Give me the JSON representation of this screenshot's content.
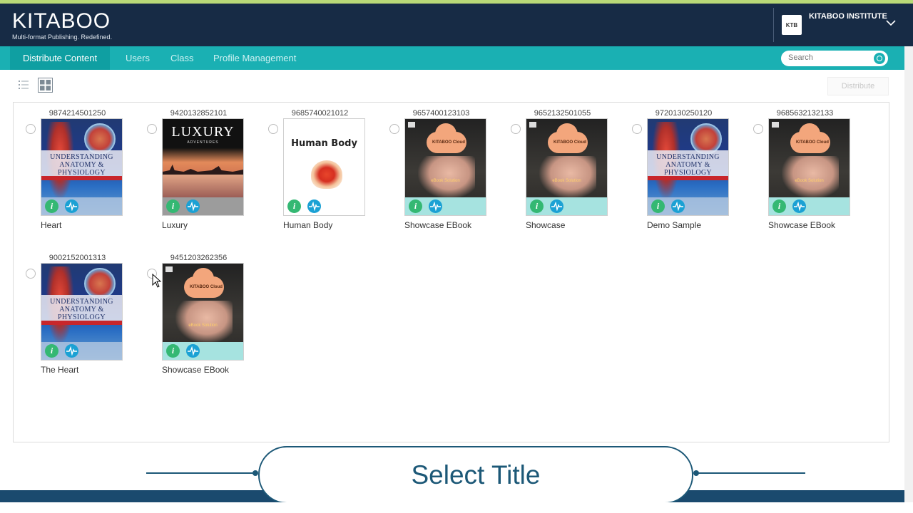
{
  "header": {
    "logo": "KITABOO",
    "tagline": "Multi-format Publishing. Redefined.",
    "institute_name": "KITABOO INSTITUTE",
    "avatar_text": "KTB"
  },
  "nav": {
    "items": [
      {
        "label": "Distribute Content",
        "active": true
      },
      {
        "label": "Users",
        "active": false
      },
      {
        "label": "Class",
        "active": false
      },
      {
        "label": "Profile Management",
        "active": false
      }
    ],
    "search_placeholder": "Search"
  },
  "toolbar": {
    "distribute_label": "Distribute"
  },
  "books": [
    {
      "isbn": "9874214501250",
      "title": "Heart",
      "cover": "anatomy"
    },
    {
      "isbn": "9420132852101",
      "title": "Luxury",
      "cover": "luxury"
    },
    {
      "isbn": "9685740021012",
      "title": "Human Body",
      "cover": "human"
    },
    {
      "isbn": "9657400123103",
      "title": "Showcase EBook",
      "cover": "showcase"
    },
    {
      "isbn": "9652132501055",
      "title": "Showcase",
      "cover": "showcase"
    },
    {
      "isbn": "9720130250120",
      "title": "Demo Sample",
      "cover": "anatomy"
    },
    {
      "isbn": "9685632132133",
      "title": "Showcase EBook",
      "cover": "showcase"
    },
    {
      "isbn": "9002152001313",
      "title": "The Heart",
      "cover": "anatomy"
    },
    {
      "isbn": "9451203262356",
      "title": "Showcase EBook",
      "cover": "showcase"
    }
  ],
  "covers": {
    "anatomy_text": "UNDERSTANDING ANATOMY & PHYSIOLOGY",
    "luxury_title": "LUXURY",
    "luxury_sub": "ADVENTURES",
    "human_title": "Human Body",
    "showcase_cloud": "KITABOO Cloud",
    "showcase_label": "eBook Solution"
  },
  "banner": {
    "text": "Select Title"
  },
  "colors": {
    "header_bg": "#172b45",
    "nav_bg": "#1ab0b3",
    "nav_active": "#0f9fa2",
    "banner_accent": "#1c5877",
    "info_icon": "#34b873",
    "pulse_icon": "#1ba1d4"
  }
}
